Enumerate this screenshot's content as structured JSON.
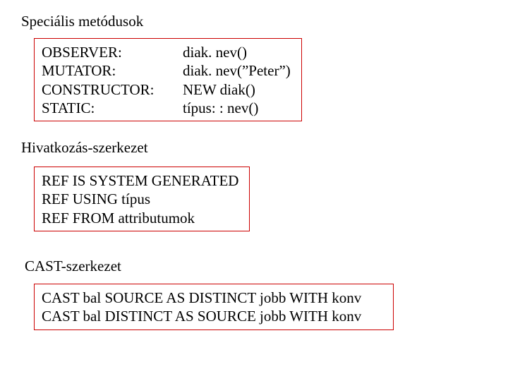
{
  "headings": {
    "special_methods": "Speciális metódusok",
    "reference_structure": "Hivatkozás-szerkezet",
    "cast_structure": "CAST-szerkezet"
  },
  "methods_box": {
    "col1": [
      "OBSERVER:",
      "MUTATOR:",
      "CONSTRUCTOR:",
      "STATIC:"
    ],
    "col2": [
      "diak. nev()",
      "diak. nev(”Peter”)",
      "NEW diak()",
      "típus: : nev()"
    ]
  },
  "ref_box": {
    "lines": [
      "REF IS SYSTEM GENERATED",
      "REF USING típus",
      "REF FROM attributumok"
    ]
  },
  "cast_box": {
    "lines": [
      "CAST bal SOURCE AS DISTINCT jobb  WITH konv",
      "CAST bal DISTINCT AS SOURCE jobb  WITH konv"
    ]
  }
}
